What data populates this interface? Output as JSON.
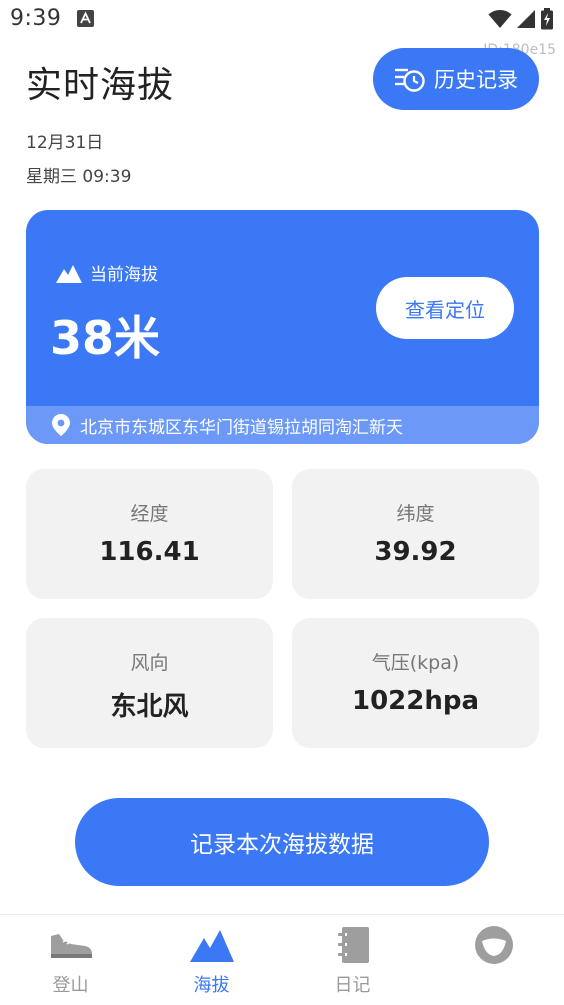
{
  "status_bar": {
    "time": "9:39",
    "icons": [
      "a-icon",
      "wifi-icon",
      "signal-icon",
      "battery-icon"
    ]
  },
  "watermark": "ID:180e15",
  "header": {
    "title": "实时海拔",
    "history_label": "历史记录",
    "date": "12月31日",
    "weekday_time": "星期三 09:39"
  },
  "altitude_card": {
    "label": "当前海拔",
    "value": "38米",
    "view_location_label": "查看定位",
    "address": "北京市东城区东华门街道锡拉胡同淘汇新天"
  },
  "info_cards": [
    {
      "label": "经度",
      "value": "116.41"
    },
    {
      "label": "纬度",
      "value": "39.92"
    },
    {
      "label": "风向",
      "value": "东北风"
    },
    {
      "label": "气压(kpa)",
      "value": "1022hpa"
    }
  ],
  "record_button_label": "记录本次海拔数据",
  "bottom_nav": {
    "active_index": 1,
    "items": [
      {
        "label": "登山",
        "icon": "shoe-icon"
      },
      {
        "label": "海拔",
        "icon": "mountain-icon"
      },
      {
        "label": "日记",
        "icon": "notebook-icon"
      },
      {
        "label": "",
        "icon": "profile-icon"
      }
    ]
  },
  "colors": {
    "accent": "#3b78f5",
    "address_bar": "#6c99f7",
    "card_bg": "#f2f2f2",
    "nav_inactive": "#999999"
  }
}
